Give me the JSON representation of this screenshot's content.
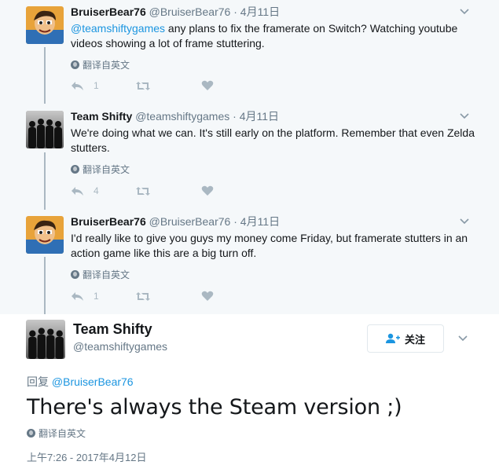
{
  "thread": [
    {
      "name": "BruiserBear76",
      "handle": "@BruiserBear76",
      "dot": "·",
      "time": "4月11日",
      "mention": "@teamshiftygames",
      "text": " any plans to fix the framerate on Switch?  Watching youtube videos showing a lot of frame stuttering.",
      "translate": "翻译自英文",
      "reply_count": "1",
      "retweet_count": "",
      "like_count": "",
      "avatar": "cartoon-avatar"
    },
    {
      "name": "Team Shifty",
      "handle": "@teamshiftygames",
      "dot": "·",
      "time": "4月11日",
      "mention": "",
      "text": "We're doing what we can. It's still early on the platform. Remember that even Zelda stutters.",
      "translate": "翻译自英文",
      "reply_count": "4",
      "retweet_count": "",
      "like_count": "",
      "avatar": "team-silhouette-avatar"
    },
    {
      "name": "BruiserBear76",
      "handle": "@BruiserBear76",
      "dot": "·",
      "time": "4月11日",
      "mention": "",
      "text": "I'd really like to give you guys my money come Friday, but framerate stutters in an action game like this are a big turn off.",
      "translate": "翻译自英文",
      "reply_count": "1",
      "retweet_count": "",
      "like_count": "",
      "avatar": "cartoon-avatar"
    }
  ],
  "main": {
    "name": "Team Shifty",
    "handle": "@teamshiftygames",
    "follow_label": "关注",
    "reply_prefix": "回复 ",
    "reply_to": "@BruiserBear76",
    "text": "There's always the Steam version ;)",
    "translate": "翻译自英文",
    "timestamp": "上午7:26 - 2017年4月12日"
  },
  "icons": [
    "reply-icon",
    "retweet-icon",
    "like-icon",
    "chevron-down-icon",
    "globe-icon",
    "follow-user-icon"
  ],
  "colors": {
    "link": "#1b95e0",
    "muted": "#657786",
    "icon": "#aab8c2",
    "thread_bg": "#f5f8fa"
  }
}
